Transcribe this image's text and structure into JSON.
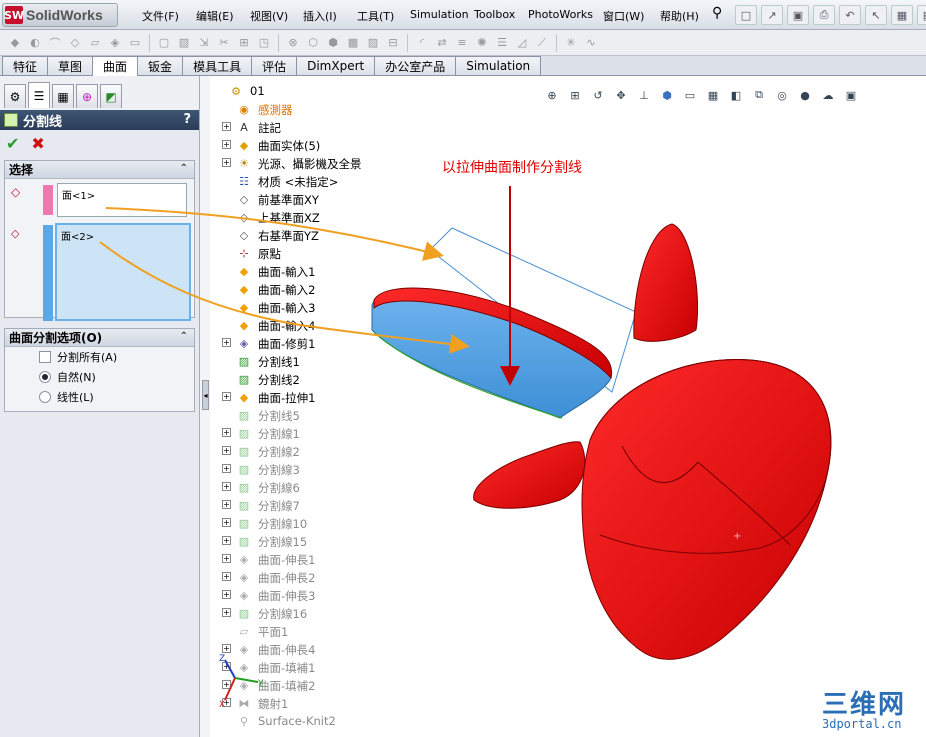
{
  "app": {
    "logo_text": "SolidWorks",
    "logo_mark": "SW"
  },
  "menu": [
    "文件(F)",
    "编辑(E)",
    "视图(V)",
    "插入(I)",
    "工具(T)",
    "Simulation",
    "Toolbox",
    "PhotoWorks",
    "窗口(W)",
    "帮助(H)"
  ],
  "command_tabs": [
    "特征",
    "草图",
    "曲面",
    "钣金",
    "模具工具",
    "评估",
    "DimXpert",
    "办公室产品",
    "Simulation"
  ],
  "active_tab": "曲面",
  "property_manager": {
    "title": "分割线",
    "help": "?",
    "ok_glyph": "✔",
    "cancel_glyph": "✖",
    "selection_group": {
      "title": "选择",
      "field1": "面<1>",
      "field2": "面<2>"
    },
    "options_group": {
      "title": "曲面分割选项(O)",
      "options": [
        {
          "type": "checkbox",
          "label": "分割所有(A)",
          "checked": false
        },
        {
          "type": "radio",
          "label": "自然(N)",
          "checked": true
        },
        {
          "type": "radio",
          "label": "线性(L)",
          "checked": false
        }
      ]
    }
  },
  "tree": [
    {
      "label": "01",
      "icon": "part-icon",
      "exp": false,
      "style": "normal"
    },
    {
      "label": "感測器",
      "icon": "sensor-icon",
      "exp": false,
      "style": "hi"
    },
    {
      "label": "註記",
      "icon": "annotation-icon",
      "exp": true,
      "style": "normal"
    },
    {
      "label": "曲面实体(5)",
      "icon": "surface-bodies-icon",
      "exp": true,
      "style": "normal"
    },
    {
      "label": "光源、攝影機及全景",
      "icon": "lights-icon",
      "exp": true,
      "style": "normal"
    },
    {
      "label": "材质 <未指定>",
      "icon": "material-icon",
      "exp": false,
      "style": "normal"
    },
    {
      "label": "前基準面XY",
      "icon": "plane-icon",
      "exp": false,
      "style": "normal"
    },
    {
      "label": "上基準面XZ",
      "icon": "plane-icon",
      "exp": false,
      "style": "normal"
    },
    {
      "label": "右基準面YZ",
      "icon": "plane-icon",
      "exp": false,
      "style": "normal"
    },
    {
      "label": "原點",
      "icon": "origin-icon",
      "exp": false,
      "style": "normal"
    },
    {
      "label": "曲面-輸入1",
      "icon": "surface-import-icon",
      "exp": false,
      "style": "normal"
    },
    {
      "label": "曲面-輸入2",
      "icon": "surface-import-icon",
      "exp": false,
      "style": "normal"
    },
    {
      "label": "曲面-輸入3",
      "icon": "surface-import-icon",
      "exp": false,
      "style": "normal"
    },
    {
      "label": "曲面-輸入4",
      "icon": "surface-import-icon",
      "exp": false,
      "style": "normal"
    },
    {
      "label": "曲面-修剪1",
      "icon": "surface-trim-icon",
      "exp": true,
      "style": "normal"
    },
    {
      "label": "分割线1",
      "icon": "split-line-icon",
      "exp": false,
      "style": "normal"
    },
    {
      "label": "分割线2",
      "icon": "split-line-icon",
      "exp": false,
      "style": "normal"
    },
    {
      "label": "曲面-拉伸1",
      "icon": "surface-extrude-icon",
      "exp": true,
      "style": "normal"
    },
    {
      "label": "分割线5",
      "icon": "split-line-icon",
      "exp": false,
      "style": "gray"
    },
    {
      "label": "分割線1",
      "icon": "split-line-icon",
      "exp": true,
      "style": "gray"
    },
    {
      "label": "分割線2",
      "icon": "split-line-icon",
      "exp": true,
      "style": "gray"
    },
    {
      "label": "分割線3",
      "icon": "split-line-icon",
      "exp": true,
      "style": "gray"
    },
    {
      "label": "分割線6",
      "icon": "split-line-icon",
      "exp": true,
      "style": "gray"
    },
    {
      "label": "分割線7",
      "icon": "split-line-icon",
      "exp": true,
      "style": "gray"
    },
    {
      "label": "分割線10",
      "icon": "split-line-icon",
      "exp": true,
      "style": "gray"
    },
    {
      "label": "分割線15",
      "icon": "split-line-icon",
      "exp": true,
      "style": "gray"
    },
    {
      "label": "曲面-伸長1",
      "icon": "surface-extend-icon",
      "exp": true,
      "style": "gray"
    },
    {
      "label": "曲面-伸長2",
      "icon": "surface-extend-icon",
      "exp": true,
      "style": "gray"
    },
    {
      "label": "曲面-伸長3",
      "icon": "surface-extend-icon",
      "exp": true,
      "style": "gray"
    },
    {
      "label": "分割線16",
      "icon": "split-line-icon",
      "exp": true,
      "style": "gray"
    },
    {
      "label": "平面1",
      "icon": "planar-surface-icon",
      "exp": false,
      "style": "gray"
    },
    {
      "label": "曲面-伸長4",
      "icon": "surface-extend-icon",
      "exp": true,
      "style": "gray"
    },
    {
      "label": "曲面-填補1",
      "icon": "surface-fill-icon",
      "exp": true,
      "style": "gray"
    },
    {
      "label": "曲面-填補2",
      "icon": "surface-fill-icon",
      "exp": true,
      "style": "gray"
    },
    {
      "label": "鏡射1",
      "icon": "mirror-icon",
      "exp": true,
      "style": "gray"
    },
    {
      "label": "Surface-Knit2",
      "icon": "knit-icon",
      "exp": false,
      "style": "gray"
    }
  ],
  "annotation": {
    "callout": "以拉伸曲面制作分割线",
    "color": "#e00000"
  },
  "axes": {
    "x": "X",
    "y": "Y",
    "z": "Z"
  },
  "watermark": {
    "line1": "三维网",
    "line2": "3dportal.cn"
  },
  "colors": {
    "model_red": "#e8060a",
    "face_blue": "#4aa0e0",
    "header_navy": "#2e4664",
    "arrow_orange": "#f0a020"
  }
}
